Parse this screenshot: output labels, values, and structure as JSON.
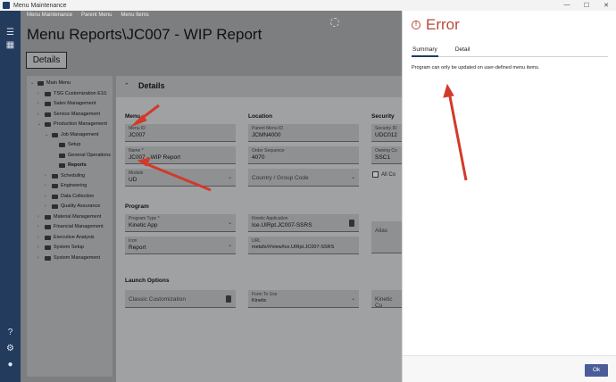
{
  "window": {
    "title": "Menu Maintenance",
    "min": "—",
    "max": "☐",
    "close": "✕"
  },
  "breadcrumb": [
    "Menu Maintenance",
    "Parent Menu",
    "Menu Items"
  ],
  "page_title": "Menu Reports\\JC007 - WIP Report",
  "details_button": "Details",
  "tree": [
    {
      "label": "Main Menu",
      "chev": "⌄"
    },
    {
      "label": "TSG Customization E10.",
      "chev": "›"
    },
    {
      "label": "Sales Management",
      "chev": "›"
    },
    {
      "label": "Service Management",
      "chev": "›"
    },
    {
      "label": "Production Management",
      "chev": "⌄"
    },
    {
      "label": "Job Management",
      "chev": "⌄"
    },
    {
      "label": "Setup",
      "chev": ""
    },
    {
      "label": "General Operations",
      "chev": ""
    },
    {
      "label": "Reports",
      "chev": ""
    },
    {
      "label": "Scheduling",
      "chev": "›"
    },
    {
      "label": "Engineering",
      "chev": "›"
    },
    {
      "label": "Data Collection",
      "chev": "›"
    },
    {
      "label": "Quality Assurance",
      "chev": "›"
    },
    {
      "label": "Material Management",
      "chev": "›"
    },
    {
      "label": "Financial Management",
      "chev": "›"
    },
    {
      "label": "Executive Analysis",
      "chev": "›"
    },
    {
      "label": "System Setup",
      "chev": "›"
    },
    {
      "label": "System Management",
      "chev": "›"
    }
  ],
  "details_panel": {
    "caret": "⌃",
    "header": "Details",
    "menu_section": "Menu",
    "location_section": "Location",
    "security_section": "Security",
    "program_section": "Program",
    "launch_section": "Launch Options",
    "menu_id": {
      "label": "Menu ID",
      "value": "JC007"
    },
    "name": {
      "label": "Name *",
      "value": "JC007 - WIP Report"
    },
    "module": {
      "label": "Module",
      "value": "UD"
    },
    "parent_menu_id": {
      "label": "Parent Menu ID",
      "value": "JCMN4000"
    },
    "order_sequence": {
      "label": "Order Sequence",
      "value": "4070"
    },
    "country_group_code": {
      "placeholder": "Country / Group Code"
    },
    "security_id": {
      "label": "Security ID",
      "value": "UDC012"
    },
    "owning_company": {
      "label": "Owning Co",
      "value": "SSC1"
    },
    "all_companies": "All Co",
    "program_type": {
      "label": "Program Type *",
      "value": "Kinetic App"
    },
    "icon": {
      "label": "Icon",
      "value": "Report"
    },
    "kinetic_application": {
      "label": "Kinetic Application",
      "value": "Ice.UIRpt.JC007-SSRS"
    },
    "url": {
      "label": "URL",
      "value": "metafx/#/view/Ice.UIRpt.JC007-SSRS"
    },
    "alias": "Alias",
    "classic_customization": "Classic Customization",
    "form_to_use": {
      "label": "Form To Use",
      "value": "Kinetic"
    },
    "kinetic_customization": "Kinetic Cu"
  },
  "error_panel": {
    "icon": "!",
    "title": "Error",
    "tabs": [
      "Summary",
      "Detail"
    ],
    "message": "Program can only be updated on user-defined menu items.",
    "ok": "Ok"
  },
  "colors": {
    "accent": "#233b5d",
    "error": "#b94a3a",
    "annotation_arrow": "#d23a2a",
    "ok_button": "#4a5c99"
  }
}
